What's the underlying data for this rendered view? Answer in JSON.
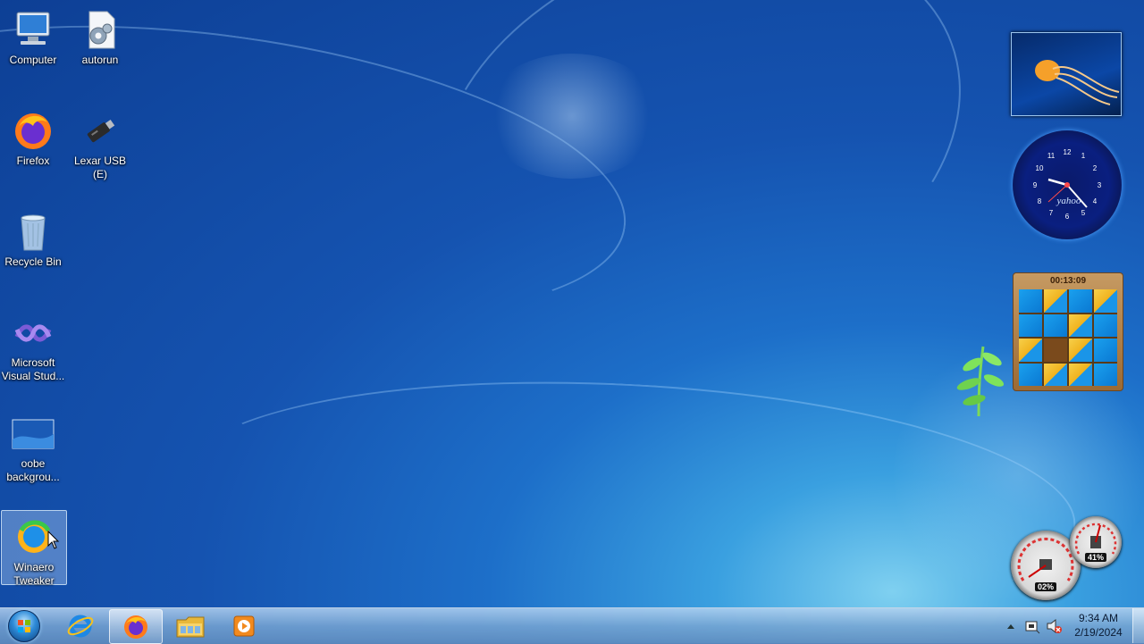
{
  "desktop": {
    "icons": [
      {
        "label": "Computer",
        "icon": "computer-icon"
      },
      {
        "label": "autorun",
        "icon": "autorun-settings-file-icon"
      },
      {
        "label": "Firefox",
        "icon": "firefox-icon"
      },
      {
        "label": "Lexar USB (E)",
        "icon": "usb-drive-icon"
      },
      {
        "label": "Recycle Bin",
        "icon": "recycle-bin-icon"
      },
      {
        "label": "Microsoft Visual Stud...",
        "icon": "visual-studio-icon"
      },
      {
        "label": "oobe backgrou...",
        "icon": "image-file-icon"
      },
      {
        "label": "Winaero Tweaker",
        "icon": "winaero-tweaker-icon"
      }
    ]
  },
  "gadgets": {
    "puzzle_timer": "00:13:09",
    "clock_brand": "yahoo",
    "clock_numbers": [
      "12",
      "1",
      "2",
      "3",
      "4",
      "5",
      "6",
      "7",
      "8",
      "9",
      "10",
      "11"
    ],
    "cpu_meter_left": "02%",
    "cpu_meter_right": "41%"
  },
  "taskbar": {
    "start": "start-orb",
    "pinned": [
      "internet-explorer-icon",
      "firefox-icon",
      "file-explorer-icon",
      "media-player-icon"
    ],
    "clock_time": "9:34 AM",
    "clock_date": "2/19/2024"
  },
  "colors": {
    "desktop_blue": "#1553b0",
    "taskbar": "#78a5d2"
  }
}
